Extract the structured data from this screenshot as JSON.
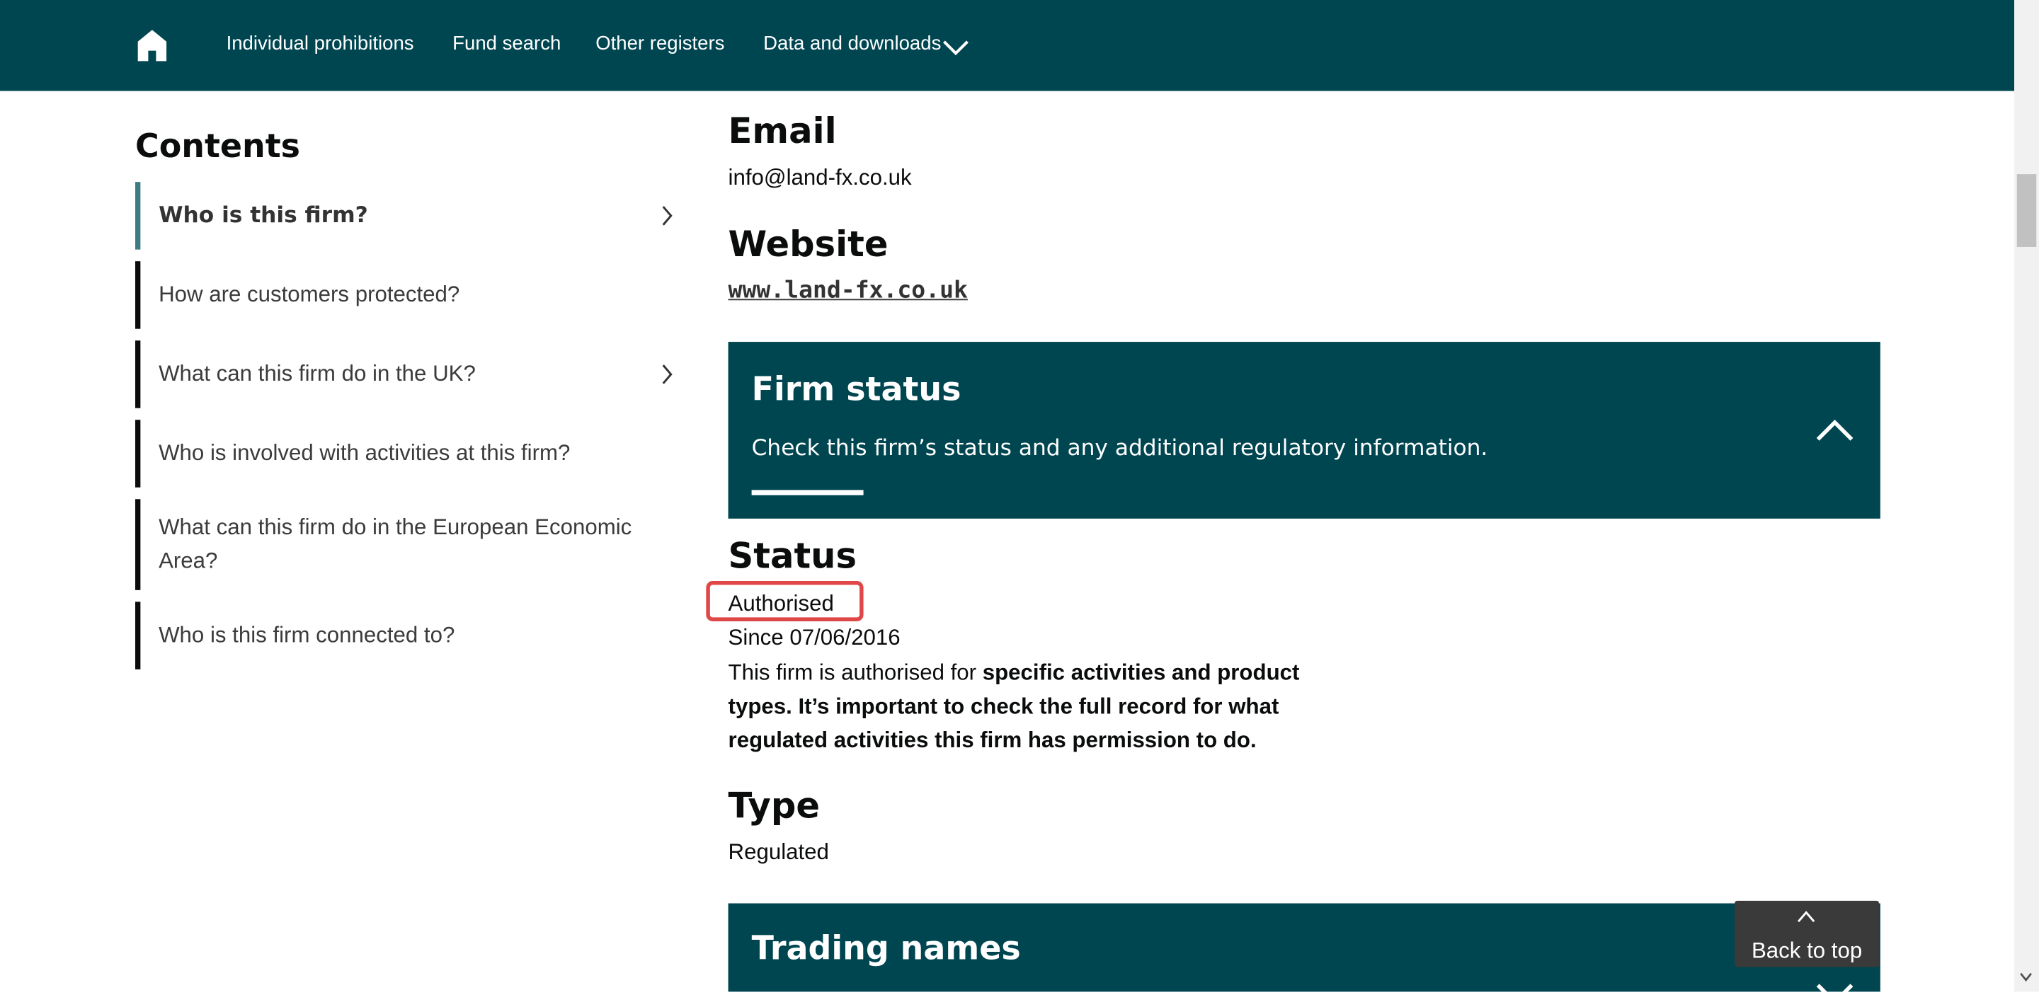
{
  "nav": {
    "items": [
      "Individual prohibitions",
      "Fund search",
      "Other registers",
      "Data and downloads"
    ]
  },
  "sidebar": {
    "title": "Contents",
    "items": [
      {
        "label": "Who is this firm?",
        "active": true,
        "has_chevron": true
      },
      {
        "label": "How are customers protected?",
        "active": false,
        "has_chevron": false
      },
      {
        "label": "What can this firm do in the UK?",
        "active": false,
        "has_chevron": true
      },
      {
        "label": "Who is involved with activities at this firm?",
        "active": false,
        "has_chevron": false
      },
      {
        "label": "What can this firm do in the European Economic Area?",
        "active": false,
        "has_chevron": false
      },
      {
        "label": "Who is this firm connected to?",
        "active": false,
        "has_chevron": false
      }
    ]
  },
  "main": {
    "email_heading": "Email",
    "email_value": "info@land-fx.co.uk",
    "website_heading": "Website",
    "website_value": "www.land-fx.co.uk",
    "firm_status_panel": {
      "title": "Firm status",
      "subtitle": "Check this firm’s status and any additional regulatory information.",
      "expanded": true
    },
    "status_heading": "Status",
    "status_value": "Authorised",
    "status_since": "Since 07/06/2016",
    "status_note_intro": "This firm is authorised for ",
    "status_note_bold": "specific activities and product types. It’s important to check the full record for what regulated activities this firm has permission to do.",
    "type_heading": "Type",
    "type_value": "Regulated",
    "trading_names_panel": {
      "title": "Trading names",
      "expanded": false
    }
  },
  "back_to_top": "Back to top",
  "colors": {
    "brand": "#004651",
    "active_marker": "#3e7c84",
    "highlight": "#e04848",
    "back_to_top_bg": "#3a3a3a"
  },
  "icons": [
    "home-icon",
    "chevron-down-icon",
    "chevron-right-icon",
    "chevron-up-icon",
    "caret-up-icon"
  ]
}
